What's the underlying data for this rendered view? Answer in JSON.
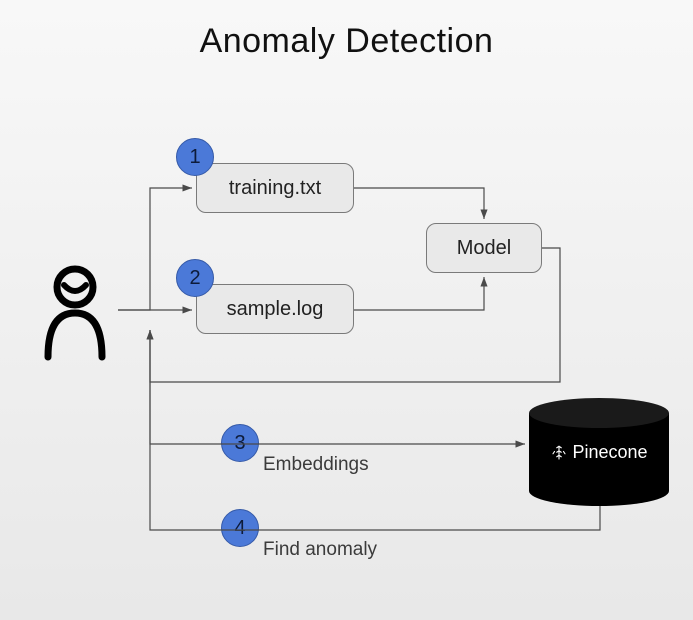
{
  "title": "Anomaly Detection",
  "badges": {
    "b1": "1",
    "b2": "2",
    "b3": "3",
    "b4": "4"
  },
  "nodes": {
    "training": "training.txt",
    "sample": "sample.log",
    "model": "Model",
    "pinecone": "Pinecone"
  },
  "labels": {
    "embeddings": "Embeddings",
    "find_anomaly": "Find anomaly"
  },
  "icons": {
    "actor": "user-icon",
    "pinecone_logo": "pinecone-logo-icon"
  },
  "colors": {
    "badge_bg": "#4b79d8",
    "box_bg": "#e9e9e9",
    "pinecone_bg": "#000000"
  }
}
